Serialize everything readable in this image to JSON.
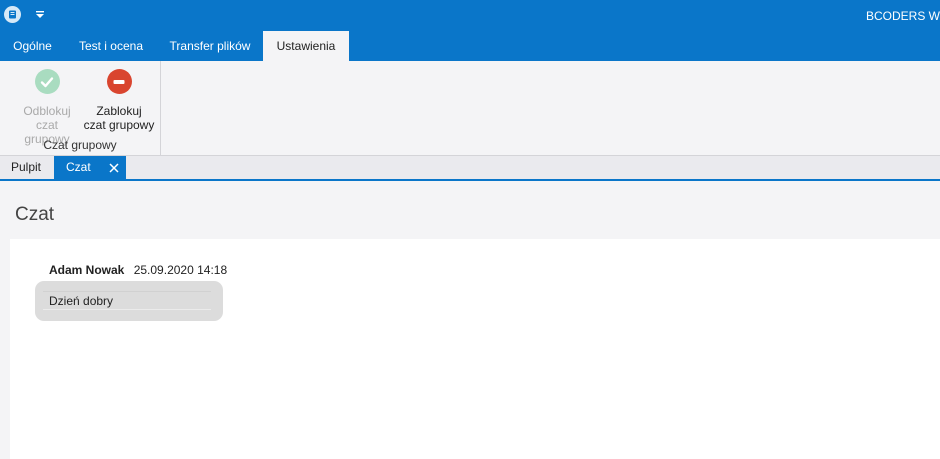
{
  "window": {
    "title": "BCODERS W",
    "app_icon": "app-logo-icon",
    "quick_access_icon": "dropdown-arrow-icon"
  },
  "ribbon": {
    "tabs": [
      {
        "label": "Ogólne"
      },
      {
        "label": "Test i ocena"
      },
      {
        "label": "Transfer plików"
      },
      {
        "label": "Ustawienia",
        "active": true
      }
    ],
    "groups": [
      {
        "label": "Czat grupowy",
        "buttons": [
          {
            "label_line1": "Odblokuj",
            "label_line2": "czat grupowy",
            "icon": "check-circle-icon",
            "enabled": false
          },
          {
            "label_line1": "Zablokuj",
            "label_line2": "czat grupowy",
            "icon": "block-circle-icon",
            "enabled": true
          }
        ]
      }
    ]
  },
  "doc_tabs": [
    {
      "label": "Pulpit"
    },
    {
      "label": "Czat",
      "active": true,
      "closable": true
    }
  ],
  "page": {
    "title": "Czat"
  },
  "chat": {
    "messages": [
      {
        "author": "Adam Nowak",
        "time": "25.09.2020 14:18",
        "text": "Dzień dobry"
      }
    ]
  },
  "colors": {
    "accent": "#0a76c9",
    "unlock_disabled": "#a9dcc0",
    "block": "#d9452f",
    "bubble": "#dcdcdc"
  }
}
